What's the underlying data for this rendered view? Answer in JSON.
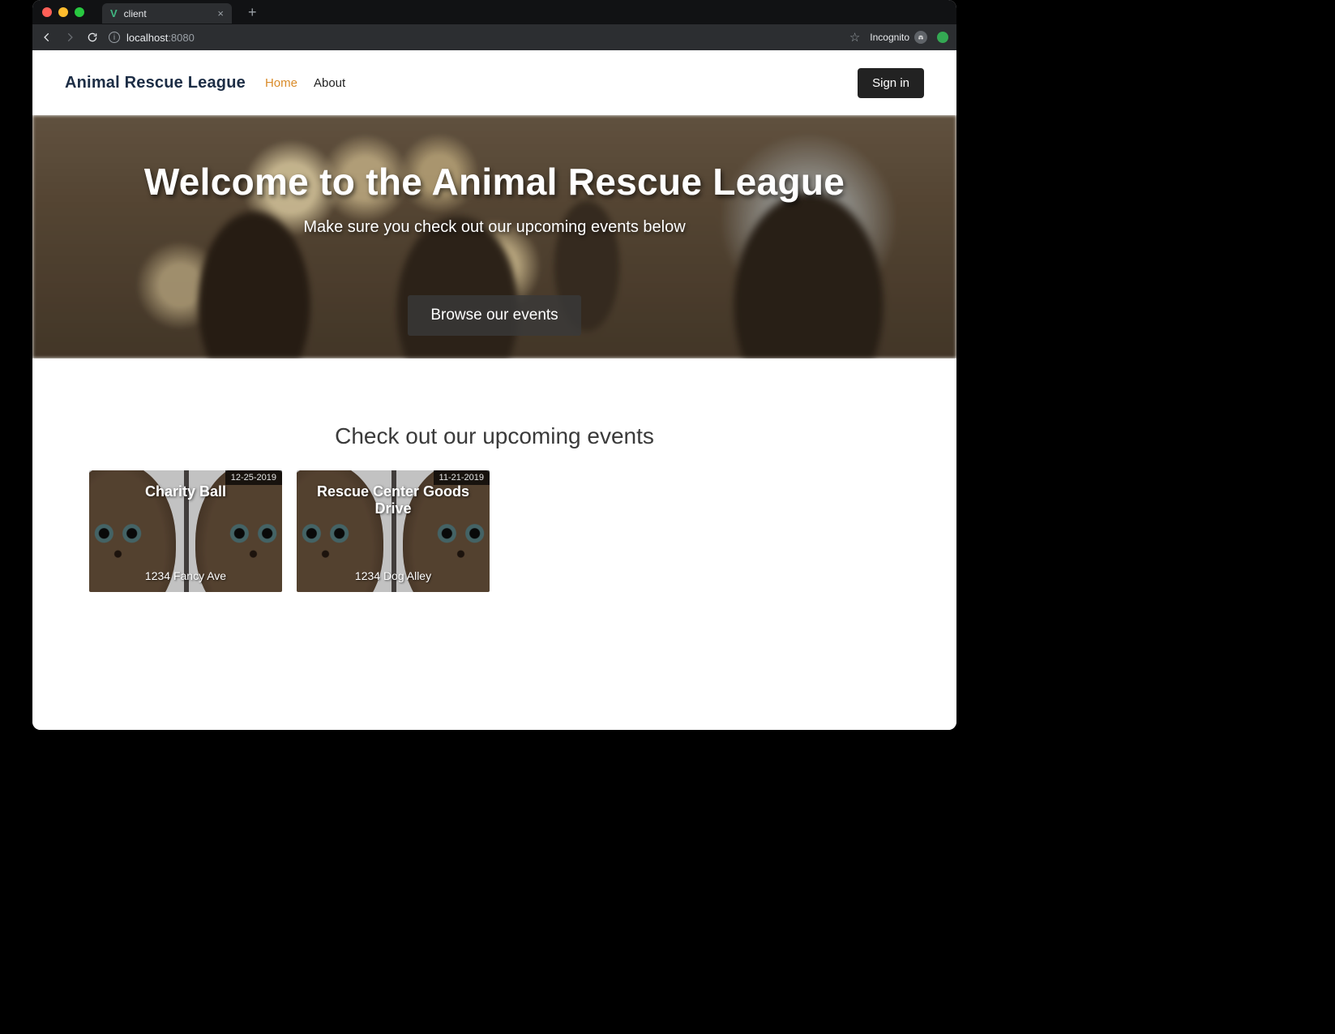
{
  "browser": {
    "tab_title": "client",
    "url_host": "localhost",
    "url_port": ":8080",
    "incognito_label": "Incognito"
  },
  "nav": {
    "brand": "Animal Rescue League",
    "links": [
      {
        "label": "Home",
        "active": true
      },
      {
        "label": "About",
        "active": false
      }
    ],
    "signin": "Sign in"
  },
  "hero": {
    "heading": "Welcome to the Animal Rescue League",
    "sub": "Make sure you check out our upcoming events below",
    "cta": "Browse our events"
  },
  "events": {
    "heading": "Check out our upcoming events",
    "cards": [
      {
        "title": "Charity Ball",
        "date": "12-25-2019",
        "location": "1234 Fancy Ave"
      },
      {
        "title": "Rescue Center Goods Drive",
        "date": "11-21-2019",
        "location": "1234 Dog Alley"
      }
    ]
  }
}
